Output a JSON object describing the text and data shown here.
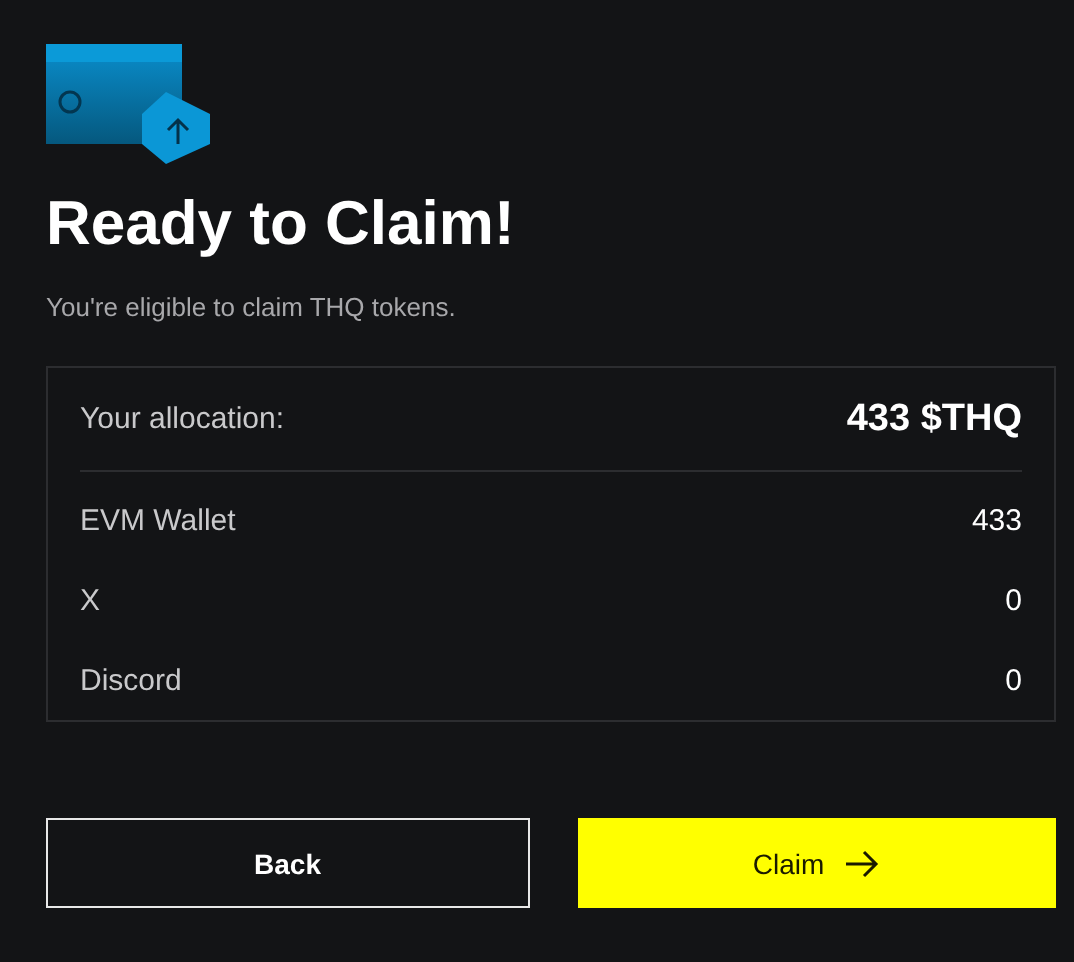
{
  "title": "Ready to Claim!",
  "subtitle": "You're eligible to claim THQ tokens.",
  "allocation": {
    "label": "Your allocation:",
    "value": "433 $THQ"
  },
  "sources": [
    {
      "label": "EVM Wallet",
      "value": "433"
    },
    {
      "label": "X",
      "value": "0"
    },
    {
      "label": "Discord",
      "value": "0"
    }
  ],
  "buttons": [
    {
      "kind": "secondary",
      "label": "Back"
    },
    {
      "kind": "primary",
      "label": "Claim"
    }
  ]
}
